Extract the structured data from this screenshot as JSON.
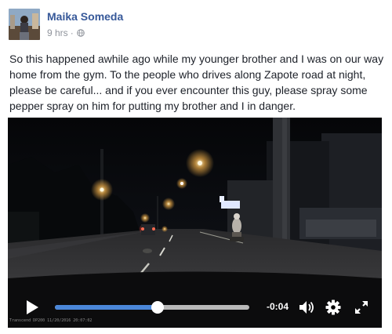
{
  "post": {
    "author": "Maika Someda",
    "time": "9 hrs",
    "separator": "·",
    "privacy_icon": "globe-icon",
    "text": "So this happened awhile ago while my younger brother and I was on our way home from the gym. To the people who drives along Zapote road at night, please be careful... and if you ever encounter this guy, please spray some pepper spray on him for putting my brother and I in danger."
  },
  "video": {
    "time_remaining": "-0:04",
    "progress": 0.53,
    "overlay_timestamp": "Transcend DP200 11/20/2016 20:07:02",
    "icons": {
      "play": "play-icon",
      "volume": "volume-icon",
      "settings": "gear-icon",
      "fullscreen": "fullscreen-icon"
    },
    "colors": {
      "progress_fill": "#4b87d8",
      "track": "#b9b9b9"
    }
  },
  "colors": {
    "author_link": "#365899",
    "meta": "#90949c",
    "text": "#1d2129"
  }
}
